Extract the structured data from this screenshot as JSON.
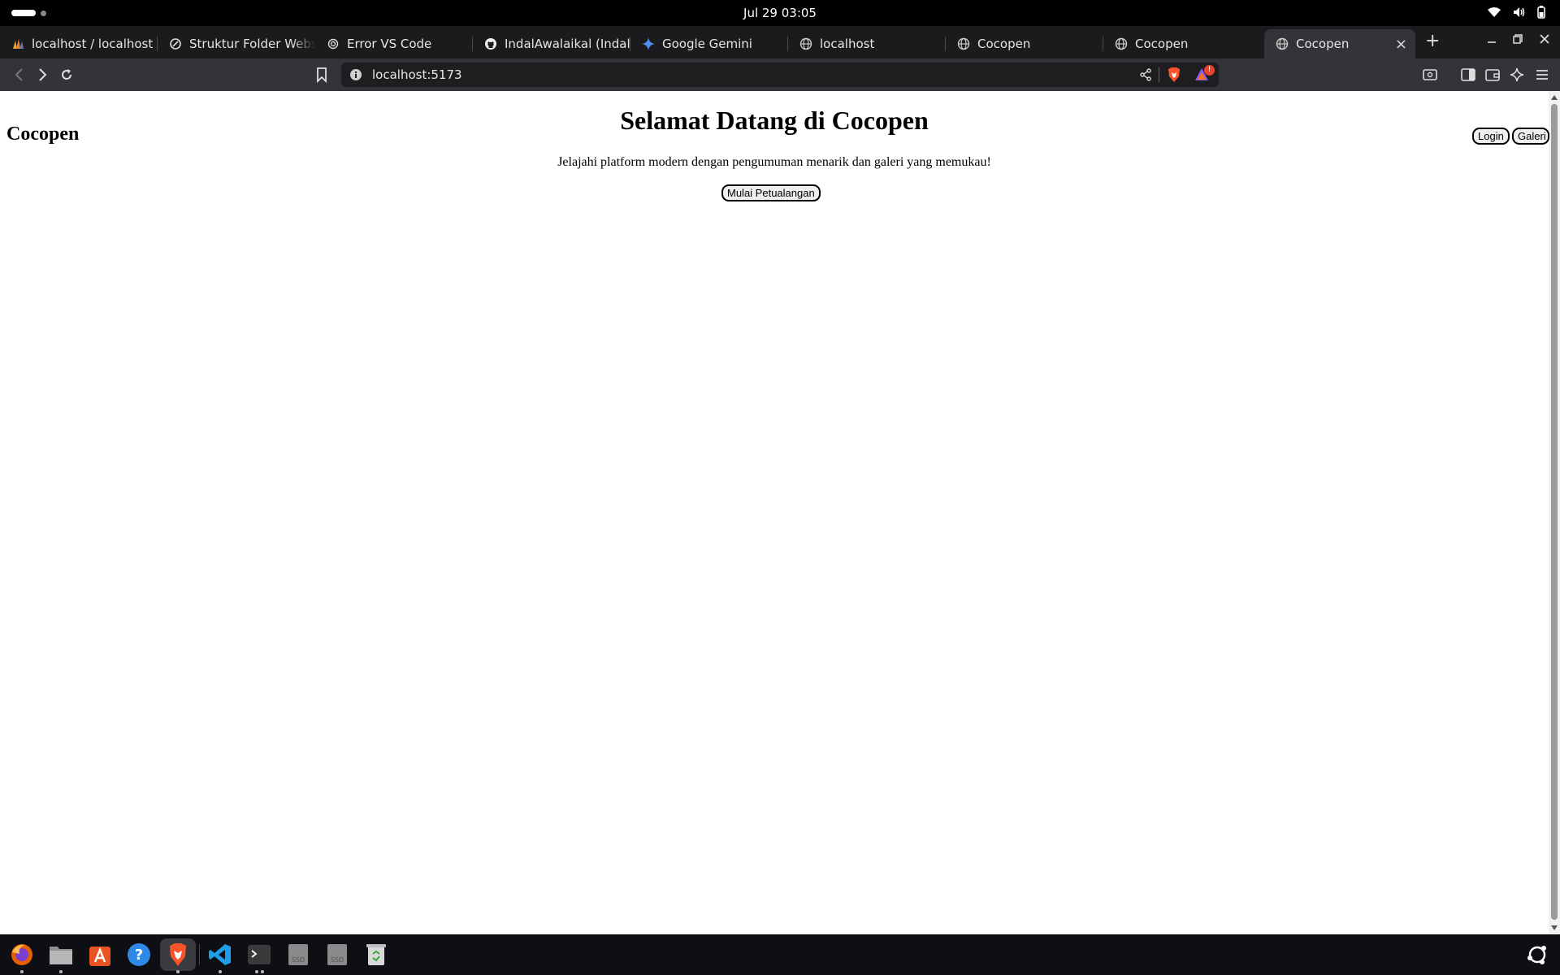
{
  "system": {
    "clock": "Jul 29  03:05"
  },
  "tabs": [
    {
      "title": "localhost / localhost / ",
      "icon": "phpmyadmin-icon"
    },
    {
      "title": "Struktur Folder Website",
      "icon": "chatgpt-icon"
    },
    {
      "title": "Error VS Code",
      "icon": "openai-icon"
    },
    {
      "title": "IndalAwalaikal (Indal ",
      "icon": "github-icon"
    },
    {
      "title": "Google Gemini",
      "icon": "gemini-icon"
    },
    {
      "title": "localhost",
      "icon": "globe-icon"
    },
    {
      "title": "Cocopen",
      "icon": "globe-icon"
    },
    {
      "title": "Cocopen",
      "icon": "globe-icon"
    },
    {
      "title": "Cocopen",
      "icon": "globe-icon",
      "active": true
    }
  ],
  "toolbar": {
    "url": "localhost:5173",
    "notification_count": "!"
  },
  "page": {
    "brand": "Cocopen",
    "hero_title": "Selamat Datang di Cocopen",
    "hero_subtitle": "Jelajahi platform modern dengan pengumuman menarik dan galeri yang memukau!",
    "cta_label": "Mulai Petualangan",
    "nav": {
      "login_label": "Login",
      "gallery_label": "Galeri"
    }
  },
  "dock": {
    "apps": [
      "firefox-icon",
      "files-icon",
      "app-center-icon",
      "help-icon",
      "brave-icon",
      "vscode-icon",
      "terminal-icon",
      "ssd-drive-icon",
      "ssd-drive-icon",
      "trash-icon"
    ],
    "drive_label": "SSD"
  },
  "colors": {
    "accent_active_tab": "#333438",
    "page_background": "#ffffff",
    "brave_orange": "#fb542b"
  }
}
